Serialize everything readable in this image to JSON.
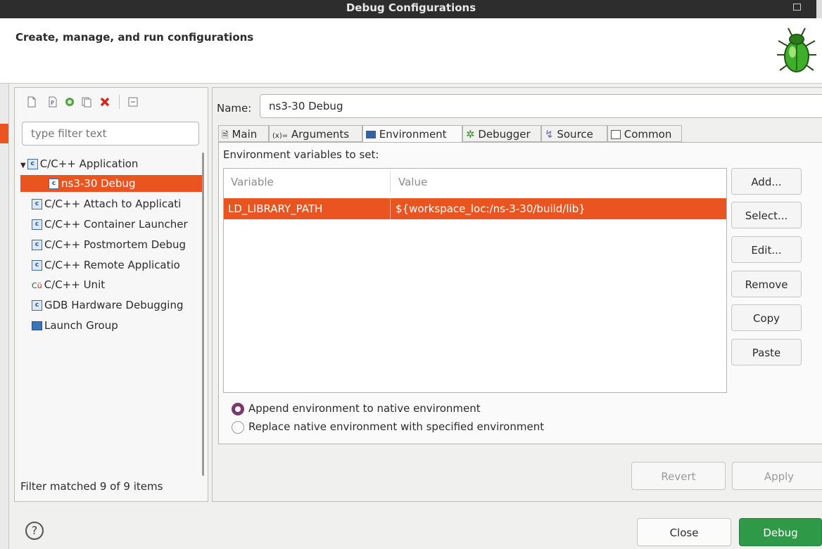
{
  "window": {
    "title": "Debug Configurations"
  },
  "header": {
    "heading": "Create, manage, and run configurations"
  },
  "left": {
    "filter_placeholder": "type filter text",
    "tree": [
      {
        "label": "C/C++ Application",
        "expanded": true
      },
      {
        "label": "ns3-30 Debug",
        "selected": true
      },
      {
        "label": "C/C++ Attach to Applicati"
      },
      {
        "label": "C/C++ Container Launcher"
      },
      {
        "label": "C/C++ Postmortem Debug"
      },
      {
        "label": "C/C++ Remote Applicatio"
      },
      {
        "label": "C/C++ Unit"
      },
      {
        "label": "GDB Hardware Debugging"
      },
      {
        "label": "Launch Group"
      }
    ],
    "filter_status": "Filter matched 9 of 9 items"
  },
  "right": {
    "name_label": "Name:",
    "name_value": "ns3-30 Debug",
    "tabs": [
      {
        "label": "Main"
      },
      {
        "label": "Arguments"
      },
      {
        "label": "Environment",
        "active": true
      },
      {
        "label": "Debugger"
      },
      {
        "label": "Source"
      },
      {
        "label": "Common"
      }
    ],
    "env": {
      "section_label": "Environment variables to set:",
      "columns": [
        "Variable",
        "Value"
      ],
      "rows": [
        {
          "variable": "LD_LIBRARY_PATH",
          "value": "${workspace_loc:/ns-3-30/build/lib}"
        }
      ],
      "buttons": [
        "Add...",
        "Select...",
        "Edit...",
        "Remove",
        "Copy",
        "Paste"
      ],
      "radio_append": "Append environment to native environment",
      "radio_replace": "Replace native environment with specified environment"
    },
    "revert": "Revert",
    "apply": "Apply"
  },
  "footer": {
    "help": "?",
    "close": "Close",
    "debug": "Debug"
  },
  "colors": {
    "accent": "#e95420",
    "debug_button": "#2e9a48",
    "radio": "#7b3a6f"
  }
}
